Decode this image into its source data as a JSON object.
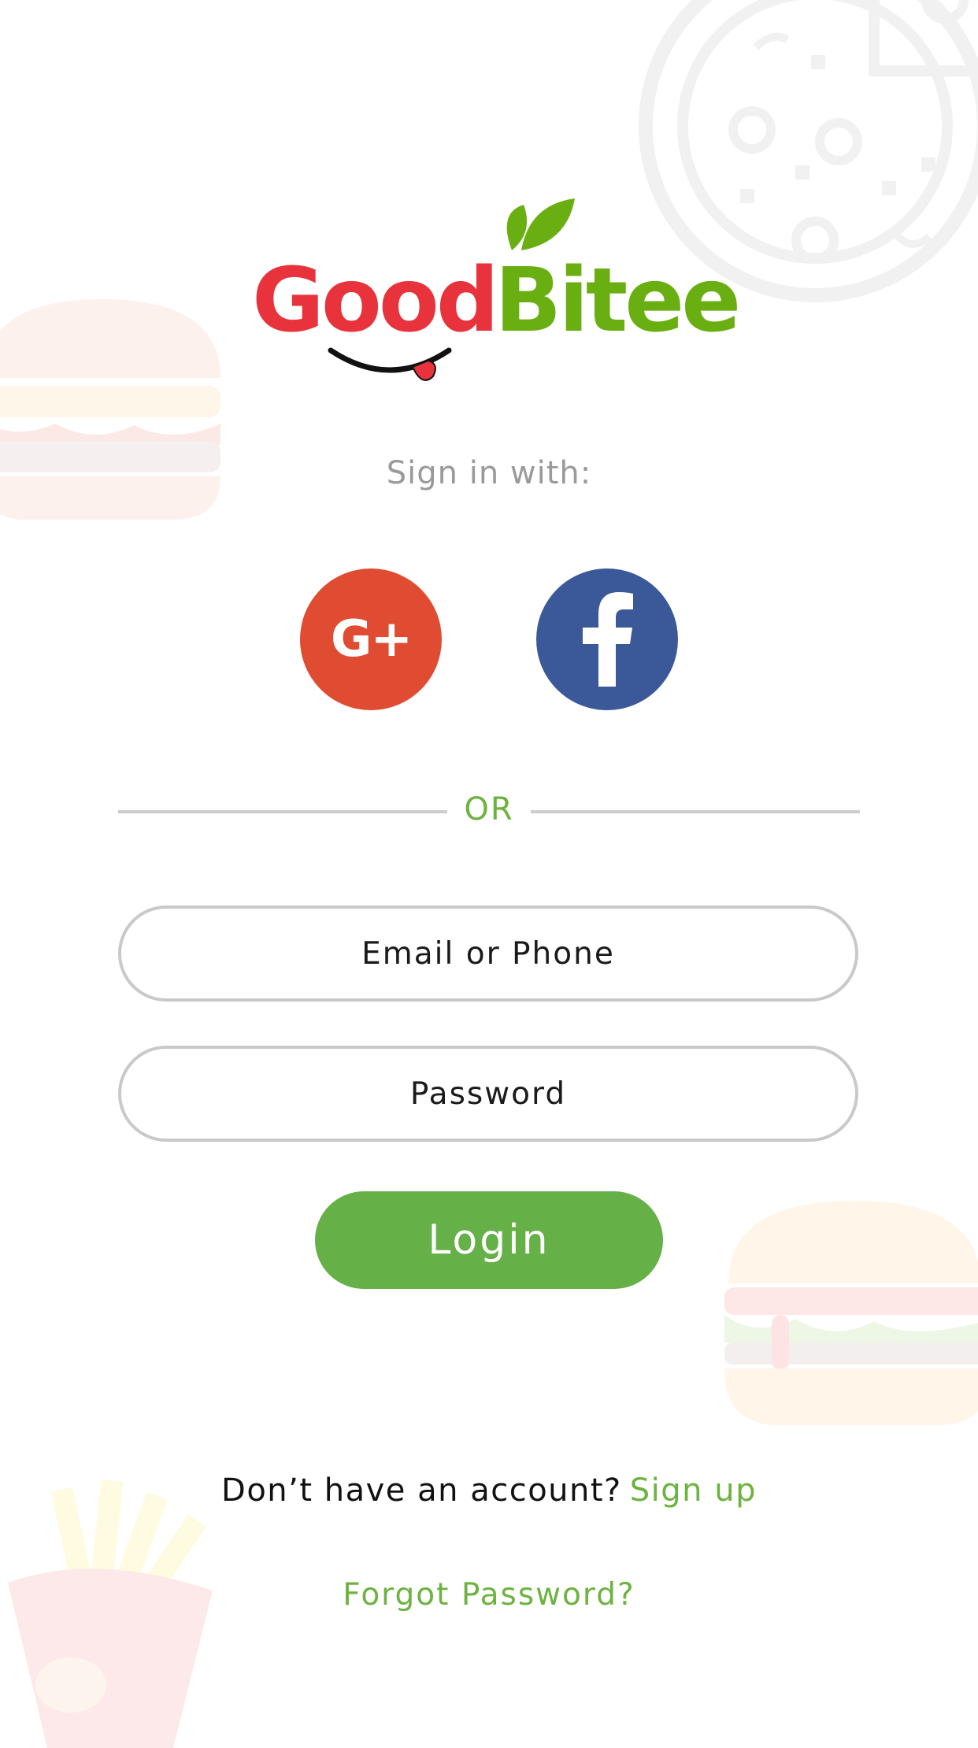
{
  "logo": {
    "brand_part1": "Good",
    "brand_part2": "Bitee",
    "colors": {
      "red": "#e8323c",
      "green": "#6aaf12"
    }
  },
  "auth": {
    "sign_in_label": "Sign in with:",
    "social": [
      {
        "name": "Google+",
        "icon": "google-plus-icon",
        "glyph": "G+",
        "color": "#e04c32"
      },
      {
        "name": "Facebook",
        "icon": "facebook-icon",
        "color": "#3b5998"
      }
    ],
    "or_label": "OR",
    "email": {
      "placeholder": "Email or Phone",
      "value": ""
    },
    "password": {
      "placeholder": "Password",
      "value": ""
    },
    "login_label": "Login",
    "signup_prompt": "Don’t have an account?",
    "signup_link": "Sign up",
    "forgot_link": "Forgot Password?"
  },
  "colors": {
    "accent_green": "#66b048",
    "link_green": "#6db33f",
    "field_border": "#c9c9c9",
    "muted_text": "#9a9a9a"
  }
}
